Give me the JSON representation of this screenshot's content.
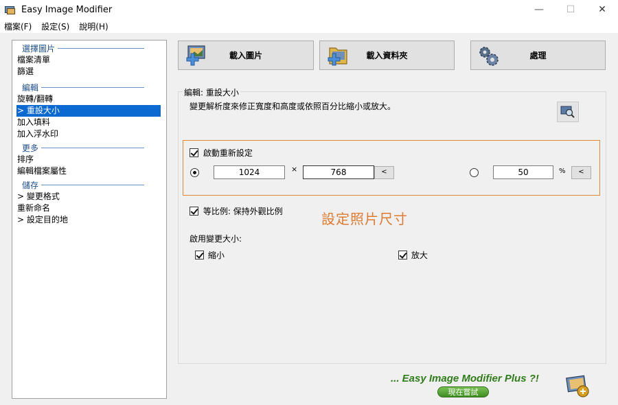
{
  "window": {
    "title": "Easy Image Modifier"
  },
  "menu": {
    "file": "檔案(F)",
    "settings": "設定(S)",
    "help": "說明(H)"
  },
  "sidebar": {
    "group_select": "選擇圖片",
    "file_list": "檔案清單",
    "filter": "篩選",
    "group_edit": "編輯",
    "rotate_flip": "旋轉/翻轉",
    "resize": "> 重設大小",
    "add_fill": "加入填料",
    "add_watermark": "加入浮水印",
    "group_more": "更多",
    "sort": "排序",
    "edit_attributes": "編輯檔案屬性",
    "group_save": "儲存",
    "change_format": "> 變更格式",
    "rename": "重新命名",
    "set_destination": "> 設定目的地"
  },
  "toolbar": {
    "load_images": "載入圖片",
    "load_folder": "載入資料夾",
    "process": "處理"
  },
  "editor": {
    "legend": "編輯: 重設大小",
    "description": "變更解析度來修正寬度和高度或依照百分比縮小或放大。",
    "enable_resize": "啟動重新設定",
    "width": "1024",
    "times": "×",
    "height": "768",
    "back_btn": "<",
    "percent": "50",
    "percent_sign": "%",
    "keep_ratio": "等比例: 保持外觀比例",
    "hint": "設定照片尺寸",
    "enable_change": "啟用變更大小:",
    "shrink": "縮小",
    "enlarge": "放大"
  },
  "footer": {
    "plus_text": "... Easy Image Modifier Plus ?!",
    "try_now": "現在嘗試"
  },
  "window_controls": {
    "minimize": "—",
    "maximize": "☐",
    "close": "✕"
  }
}
